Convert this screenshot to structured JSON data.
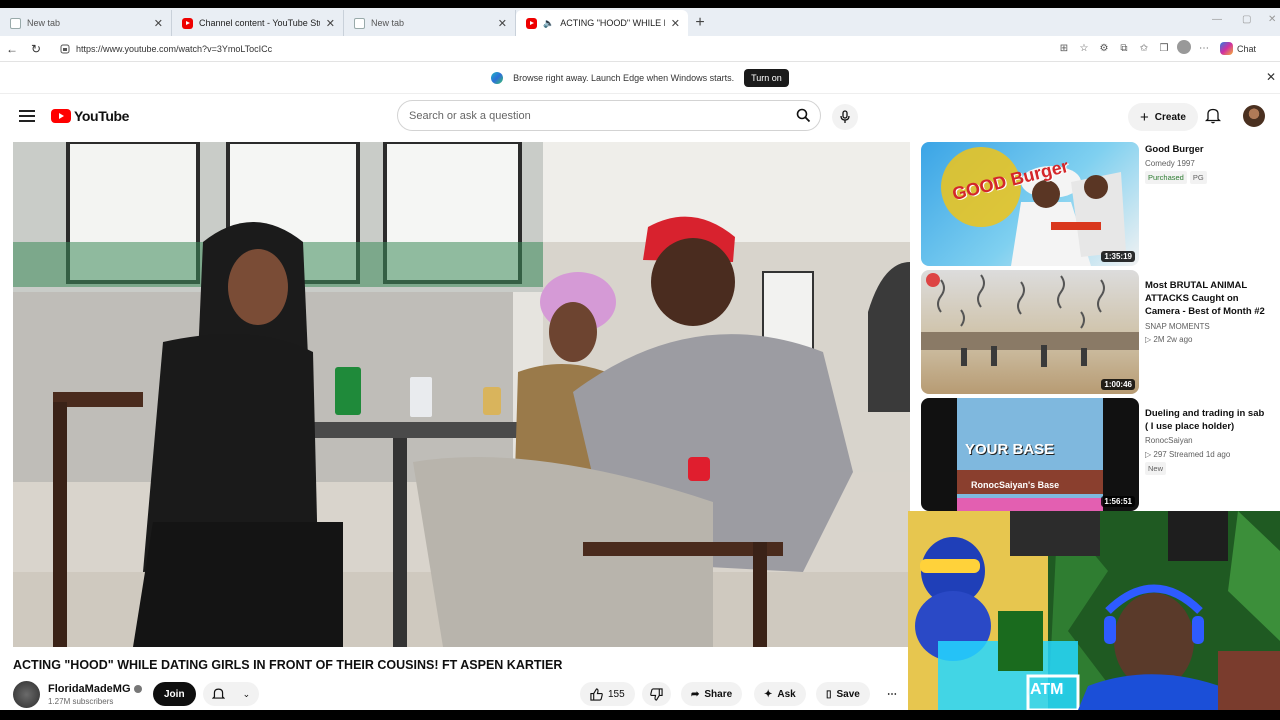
{
  "browser": {
    "tabs": [
      {
        "title": "New tab",
        "favicon": "newtab-icon",
        "active": false
      },
      {
        "title": "Channel content - YouTube Studio",
        "favicon": "youtube-icon",
        "active": false
      },
      {
        "title": "New tab",
        "favicon": "newtab-icon",
        "active": false
      },
      {
        "title": "ACTING \"HOOD\" WHILE DATING",
        "favicon": "youtube-icon",
        "active": true,
        "audio": "speaker-icon"
      }
    ],
    "url": "https://www.youtube.com/watch?v=3YmoLTocICc",
    "copilot_label": "Chat",
    "infobar": {
      "message": "Browse right away. Launch Edge when Windows starts.",
      "button": "Turn on"
    }
  },
  "youtube": {
    "logo_text": "YouTube",
    "search_placeholder": "Search or ask a question",
    "create_label": "Create",
    "accent": "#ff0000"
  },
  "video": {
    "title": "ACTING \"HOOD\" WHILE DATING GIRLS IN FRONT OF THEIR COUSINS! FT ASPEN KARTIER",
    "channel": "FloridaMadeMG",
    "subscribers": "1.27M subscribers",
    "join_label": "Join",
    "likes": "155",
    "share_label": "Share",
    "ask_label": "Ask",
    "save_label": "Save"
  },
  "recommendations": [
    {
      "title": "Good Burger",
      "meta1": "Comedy 1997",
      "badges": [
        "Purchased",
        "PG"
      ],
      "duration": "1:35:19",
      "thumb_text": "GOOD Burger"
    },
    {
      "title": "Most BRUTAL ANIMAL ATTACKS Caught on Camera - Best of Month #2",
      "meta1": "SNAP MOMENTS",
      "meta2": "▷ 2M  2w ago",
      "duration": "1:00:46"
    },
    {
      "title": "Dueling and trading in sab ( I use place holder)",
      "meta1": "RonocSaiyan",
      "meta2": "▷ 297  Streamed 1d ago",
      "badges": [
        "New"
      ],
      "duration": "1:56:51",
      "thumb_text": "YOUR BASE",
      "thumb_text2": "RonocSaiyan's Base"
    }
  ],
  "webcam": {
    "sign_text": "ATM"
  }
}
